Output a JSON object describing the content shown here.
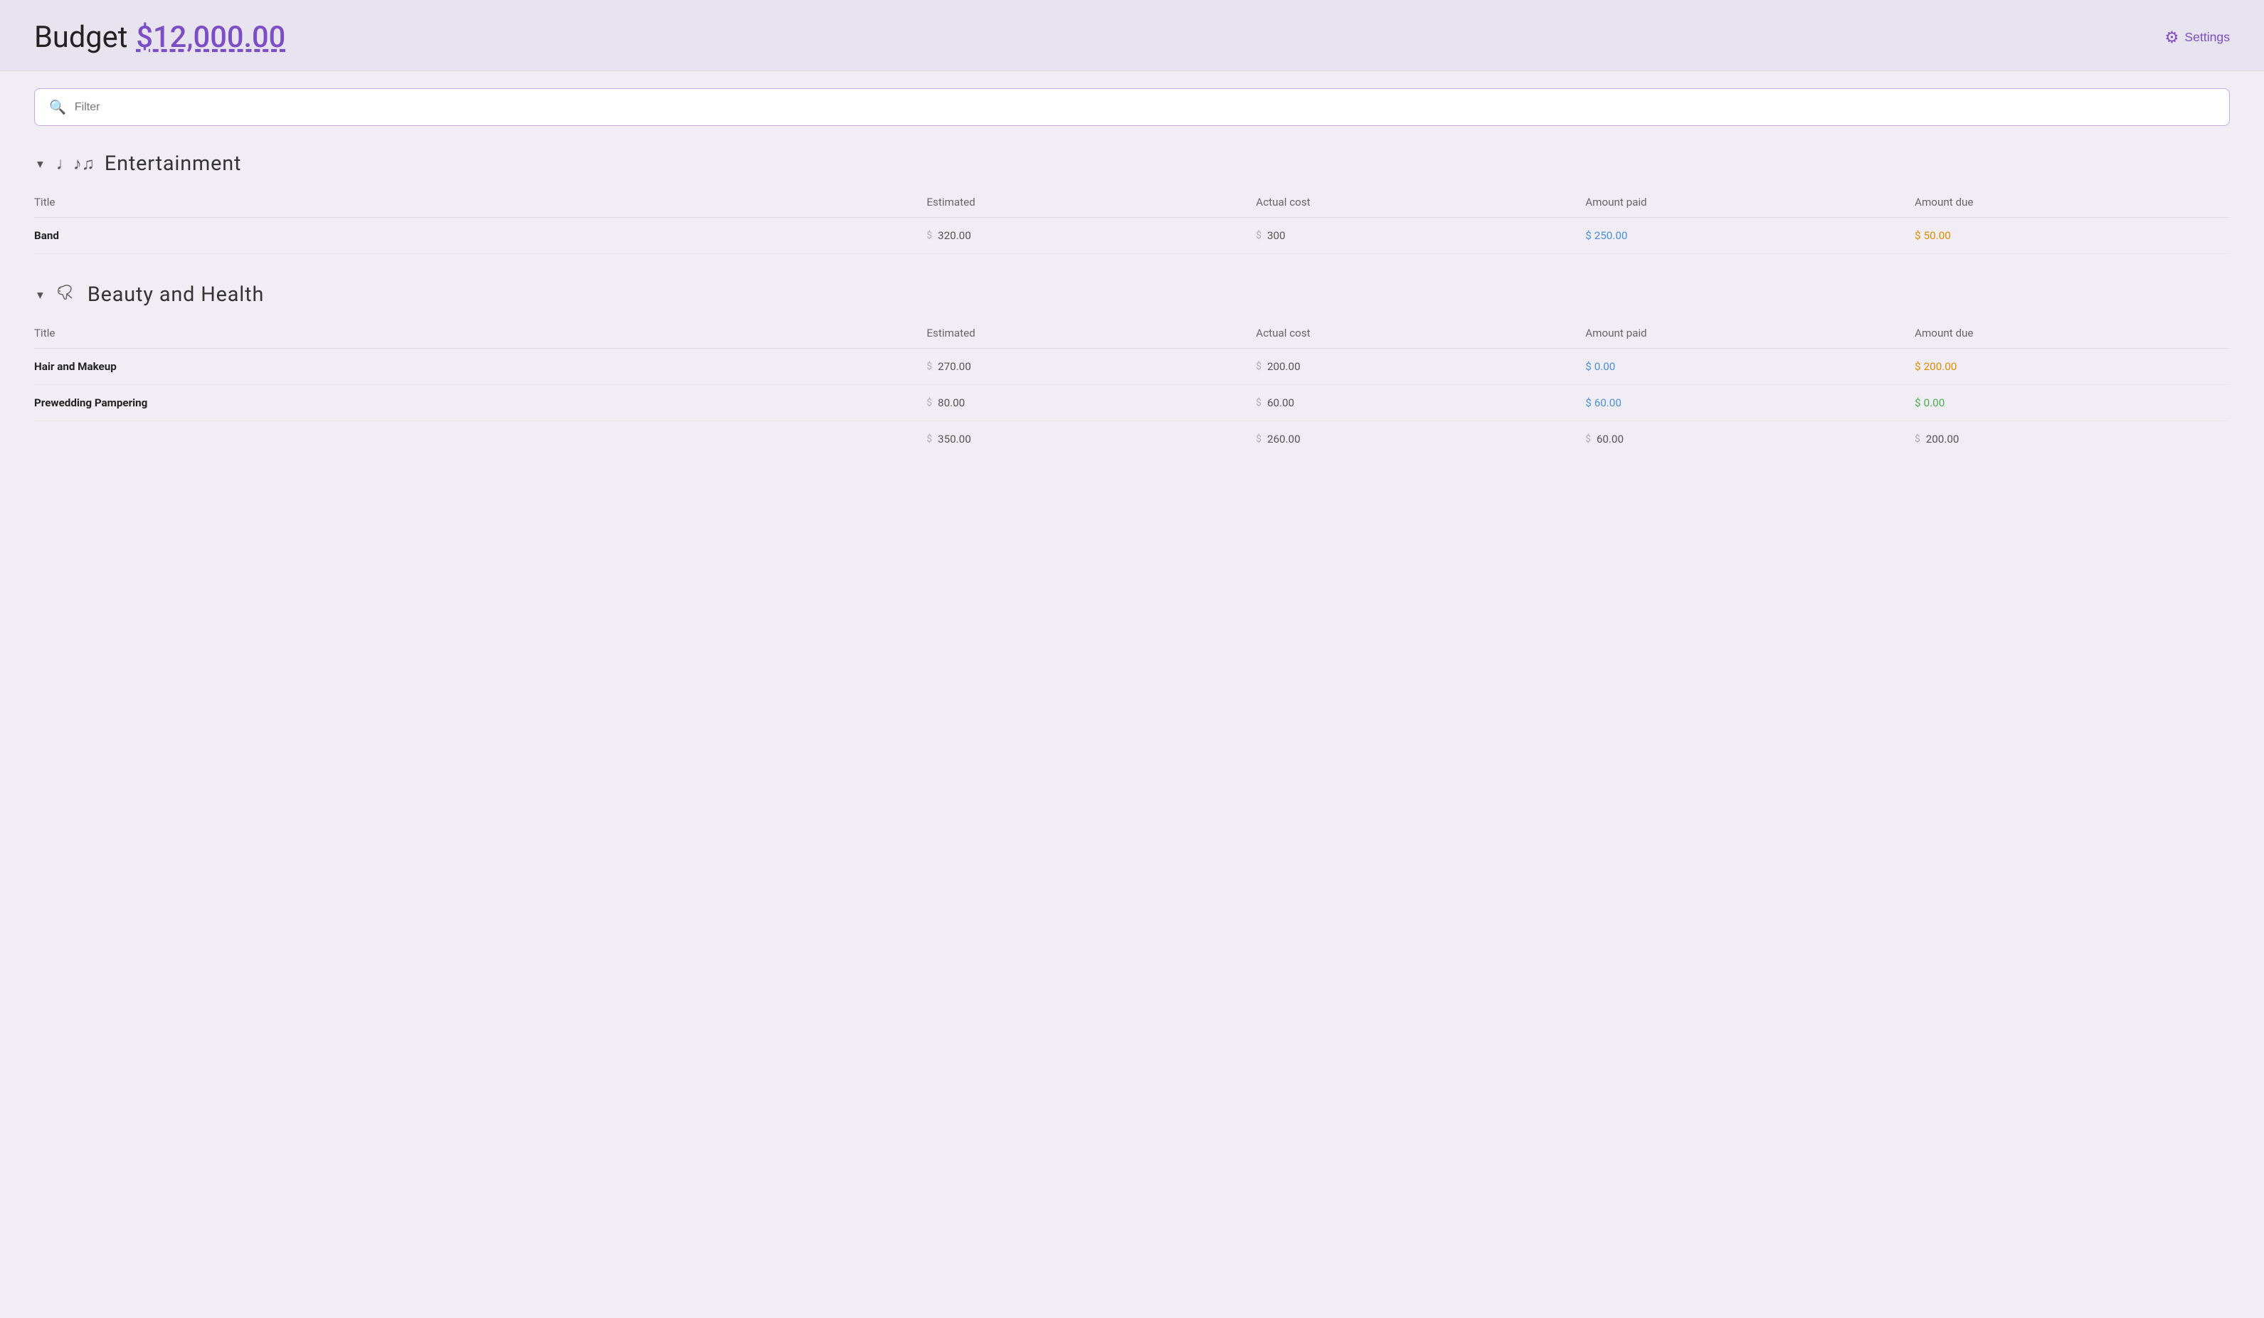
{
  "header": {
    "title": "Budget",
    "budget_amount": "$12,000.00",
    "settings_label": "Settings"
  },
  "filter": {
    "placeholder": "Filter"
  },
  "categories": [
    {
      "id": "entertainment",
      "icon": "♩♪♫",
      "icon_name": "music-icon",
      "title": "Entertainment",
      "columns": {
        "title": "Title",
        "estimated": "Estimated",
        "actual_cost": "Actual cost",
        "amount_paid": "Amount paid",
        "amount_due": "Amount due"
      },
      "items": [
        {
          "title": "Band",
          "estimated": "320.00",
          "actual_cost": "300",
          "amount_paid": "250.00",
          "amount_due": "50.00",
          "paid_color": "blue",
          "due_color": "orange"
        }
      ],
      "totals": null
    },
    {
      "id": "beauty",
      "icon": "💨",
      "icon_name": "hairdryer-icon",
      "title": "Beauty and Health",
      "columns": {
        "title": "Title",
        "estimated": "Estimated",
        "actual_cost": "Actual cost",
        "amount_paid": "Amount paid",
        "amount_due": "Amount due"
      },
      "items": [
        {
          "title": "Hair and Makeup",
          "estimated": "270.00",
          "actual_cost": "200.00",
          "amount_paid": "0.00",
          "amount_due": "200.00",
          "paid_color": "blue",
          "due_color": "orange"
        },
        {
          "title": "Prewedding Pampering",
          "estimated": "80.00",
          "actual_cost": "60.00",
          "amount_paid": "60.00",
          "amount_due": "0.00",
          "paid_color": "blue",
          "due_color": "green"
        }
      ],
      "totals": {
        "estimated": "350.00",
        "actual_cost": "260.00",
        "amount_paid": "60.00",
        "amount_due": "200.00"
      }
    }
  ]
}
